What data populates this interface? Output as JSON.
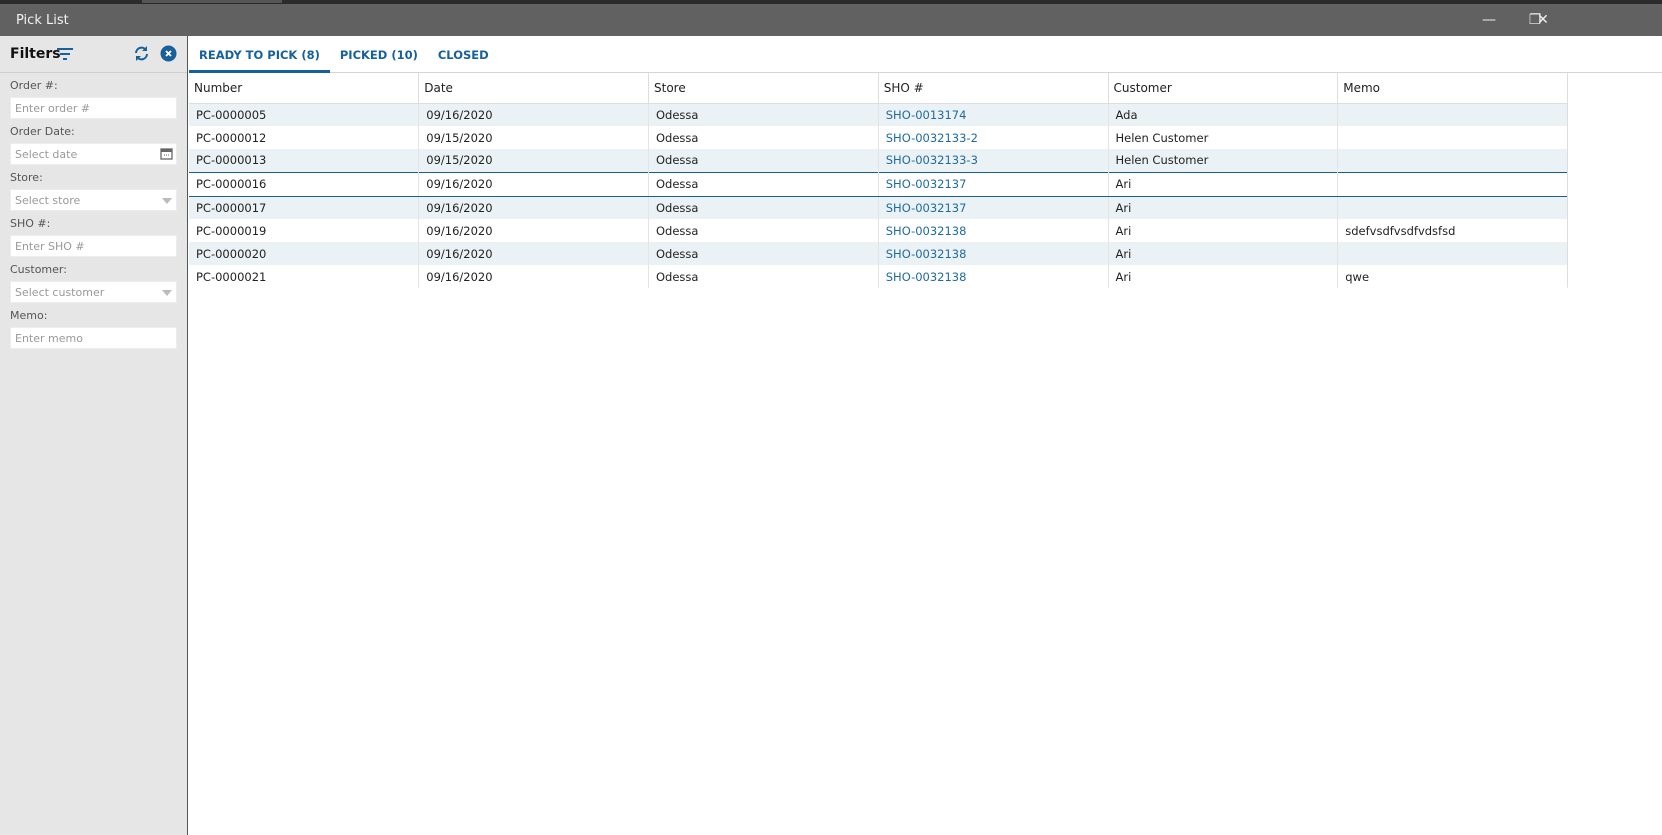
{
  "window": {
    "title": "Pick List",
    "controls": [
      "minimize",
      "restore",
      "close"
    ]
  },
  "filters": {
    "title": "Filters",
    "fields": [
      {
        "label": "Order #:",
        "placeholder": "Enter order #",
        "type": "text"
      },
      {
        "label": "Order Date:",
        "placeholder": "Select date",
        "type": "date"
      },
      {
        "label": "Store:",
        "placeholder": "Select store",
        "type": "select"
      },
      {
        "label": "SHO #:",
        "placeholder": "Enter SHO #",
        "type": "text"
      },
      {
        "label": "Customer:",
        "placeholder": "Select customer",
        "type": "select"
      },
      {
        "label": "Memo:",
        "placeholder": "Enter memo",
        "type": "text"
      }
    ]
  },
  "tabs": [
    {
      "label": "READY TO PICK (8)",
      "active": true
    },
    {
      "label": "PICKED (10)"
    },
    {
      "label": "CLOSED"
    }
  ],
  "table": {
    "columns": [
      "Number",
      "Date",
      "Store",
      "SHO #",
      "Customer",
      "Memo"
    ],
    "rows": [
      [
        "PC-0000005",
        "09/16/2020",
        "Odessa",
        "SHO-0013174",
        "Ada",
        ""
      ],
      [
        "PC-0000012",
        "09/15/2020",
        "Odessa",
        "SHO-0032133-2",
        "Helen Customer",
        ""
      ],
      [
        "PC-0000013",
        "09/15/2020",
        "Odessa",
        "SHO-0032133-3",
        "Helen Customer",
        ""
      ],
      [
        "PC-0000016",
        "09/16/2020",
        "Odessa",
        "SHO-0032137",
        "Ari",
        ""
      ],
      [
        "PC-0000017",
        "09/16/2020",
        "Odessa",
        "SHO-0032137",
        "Ari",
        ""
      ],
      [
        "PC-0000019",
        "09/16/2020",
        "Odessa",
        "SHO-0032138",
        "Ari",
        "sdefvsdfvsdfvdsfsd"
      ],
      [
        "PC-0000020",
        "09/16/2020",
        "Odessa",
        "SHO-0032138",
        "Ari",
        ""
      ],
      [
        "PC-0000021",
        "09/16/2020",
        "Odessa",
        "SHO-0032138",
        "Ari",
        "qwe"
      ]
    ],
    "selected_row": 3
  },
  "colors": {
    "accent": "#17609a",
    "titlebar": "#616161",
    "row_alt": "#ebf2f5"
  }
}
